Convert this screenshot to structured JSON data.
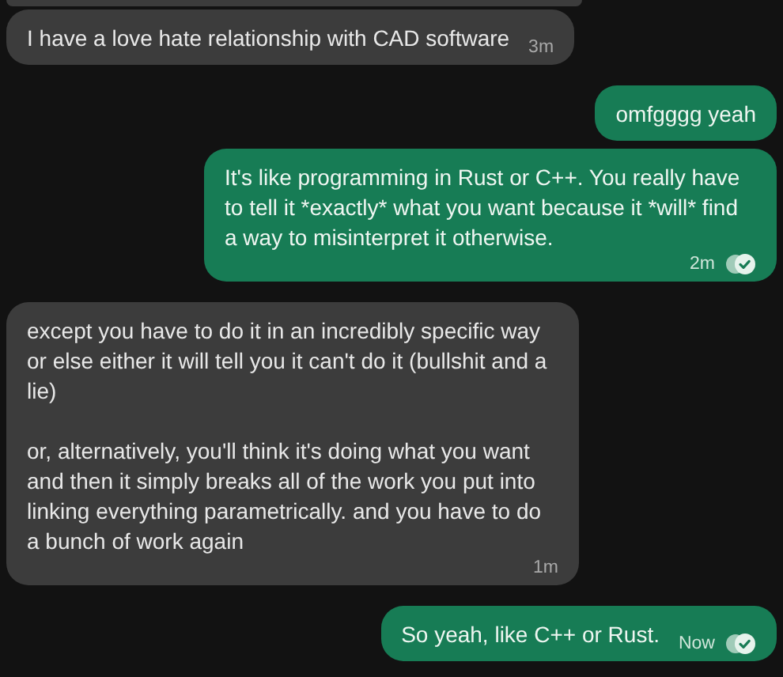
{
  "messages": [
    {
      "kind": "incoming",
      "text": "I have a love hate relationship with CAD software",
      "time": "3m",
      "read": false
    },
    {
      "kind": "outgoing",
      "text": "omfgggg yeah",
      "read": false
    },
    {
      "kind": "outgoing",
      "text": "It's like programming in Rust or C++. You really have to tell it *exactly* what you want because it *will* find a way to misinterpret it otherwise.",
      "time": "2m",
      "read": true
    },
    {
      "kind": "incoming",
      "text": "except you have to do it in an incredibly specific way or else either it will tell you it can't do it (bullshit and a lie)\n\nor, alternatively, you'll think it's doing what you want and then it simply breaks all of the work you put into linking everything parametrically. and you have to do a bunch of work again",
      "time": "1m",
      "read": false
    },
    {
      "kind": "outgoing",
      "text": "So yeah, like C++ or Rust.",
      "time": "Now",
      "read": true
    }
  ]
}
